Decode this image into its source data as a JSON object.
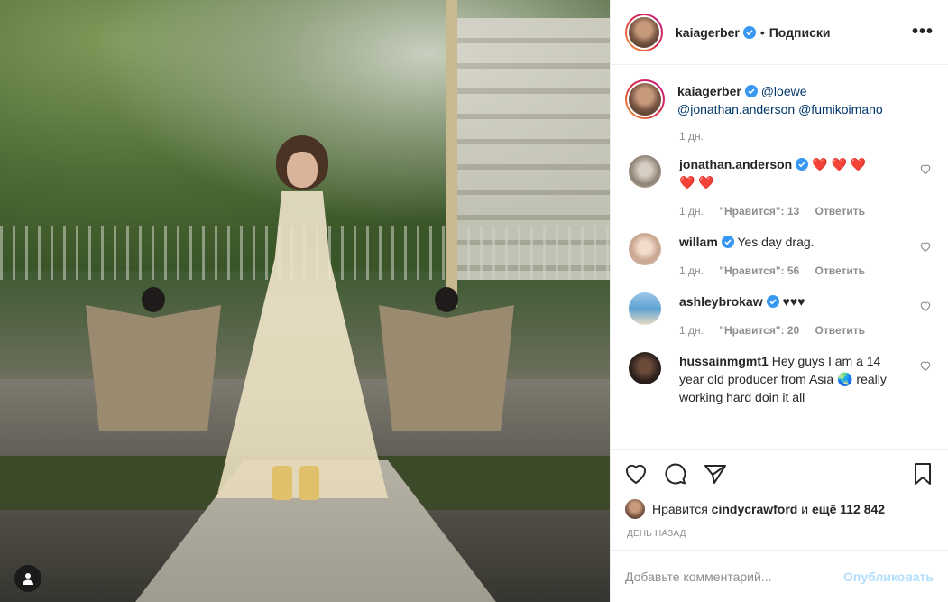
{
  "post": {
    "author": "kaiagerber",
    "separator": "•",
    "follow_label": "Подписки",
    "more_label": "•••"
  },
  "caption": {
    "author": "kaiagerber",
    "mention1": "@loewe",
    "mention2": "@jonathan.anderson",
    "mention3": "@fumikoimano",
    "time": "1 дн."
  },
  "comments": [
    {
      "user": "jonathan.anderson",
      "verified": true,
      "text": "❤️ ❤️ ❤️",
      "text2": "❤️ ❤️",
      "time": "1 дн.",
      "likes": "\"Нравится\": 13",
      "reply": "Ответить"
    },
    {
      "user": "willam",
      "verified": true,
      "text": "Yes day drag.",
      "time": "1 дн.",
      "likes": "\"Нравится\": 56",
      "reply": "Ответить"
    },
    {
      "user": "ashleybrokaw",
      "verified": true,
      "text": "♥♥♥",
      "time": "1 дн.",
      "likes": "\"Нравится\": 20",
      "reply": "Ответить"
    },
    {
      "user": "hussainmgmt1",
      "verified": false,
      "text": "Hey guys I am a 14 year old producer from Asia 🌏 really working hard doin it all"
    }
  ],
  "likes": {
    "prefix": "Нравится",
    "user": "cindycrawford",
    "joiner": "и",
    "count": "ещё 112 842"
  },
  "posted": "День назад",
  "add_comment": {
    "placeholder": "Добавьте комментарий...",
    "publish_label": "Опубликовать"
  },
  "colors": {
    "link": "#00376b",
    "verified": "#3897f0",
    "publish_disabled": "#b2dffc",
    "muted": "#8e8e8e"
  }
}
